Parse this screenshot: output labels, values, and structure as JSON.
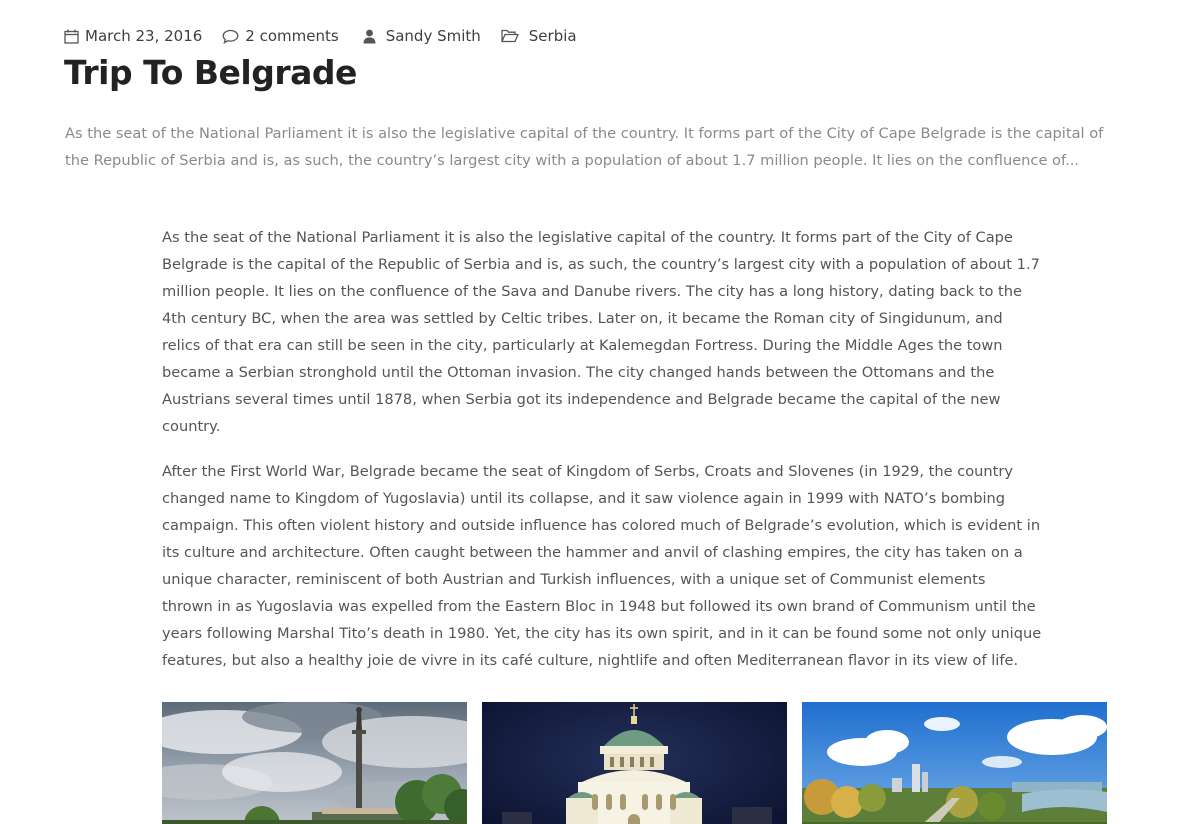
{
  "post": {
    "meta": {
      "date": "March 23, 2016",
      "comments": "2 comments",
      "author": "Sandy Smith",
      "category": "Serbia"
    },
    "title": "Trip To Belgrade",
    "excerpt_lines": [
      "As the seat of the National Parliament it is also the legislative capital of the country. It forms part of the City of Cape Belgrade is the capital of",
      "the Republic of Serbia and is, as such, the country’s largest city with a population of about 1.7 million people. It lies on the confluence of..."
    ],
    "paragraphs": [
      [
        "As the seat of the National Parliament it is also the legislative capital of the country. It forms part of the City of Cape",
        "Belgrade is the capital of the Republic of Serbia and is, as such, the country’s largest city with a population of about 1.7",
        "million people. It lies on the confluence of the Sava and Danube rivers. The city has a long history, dating back to the",
        "4th century BC, when the area was settled by Celtic tribes. Later on, it became the Roman city of Singidunum, and",
        "relics of that era can still be seen in the city, particularly at Kalemegdan Fortress. During the Middle Ages the town",
        "became a Serbian stronghold until the Ottoman invasion. The city changed hands between the Ottomans and the",
        "Austrians several times until 1878, when Serbia got its independence and Belgrade became the capital of the new",
        "country."
      ],
      [
        "After the First World War, Belgrade became the seat of Kingdom of Serbs, Croats and Slovenes (in 1929, the country",
        "changed name to Kingdom of Yugoslavia) until its collapse, and it saw violence again in 1999 with NATO’s bombing",
        "campaign. This often violent history and outside influence has colored much of Belgrade’s evolution, which is evident in",
        "its culture and architecture. Often caught between the hammer and anvil of clashing empires, the city has taken on a",
        "unique character, reminiscent of both Austrian and Turkish influences, with a unique set of Communist elements",
        "thrown in as Yugoslavia was expelled from the Eastern Bloc in 1948 but followed its own brand of Communism until the",
        "years following Marshal Tito’s death in 1980. Yet, the city has its own spirit, and in it can be found some not only unique",
        "features, but also a healthy joie de vivre in its café culture, nightlife and often Mediterranean flavor in its view of life."
      ]
    ],
    "gallery": [
      {
        "icon": "victor-monument-photo"
      },
      {
        "icon": "saint-sava-temple-photo"
      },
      {
        "icon": "city-park-panorama-photo"
      }
    ]
  },
  "colors": {
    "title": "#222222",
    "excerpt": "#8a8a8a",
    "body": "#555555"
  }
}
